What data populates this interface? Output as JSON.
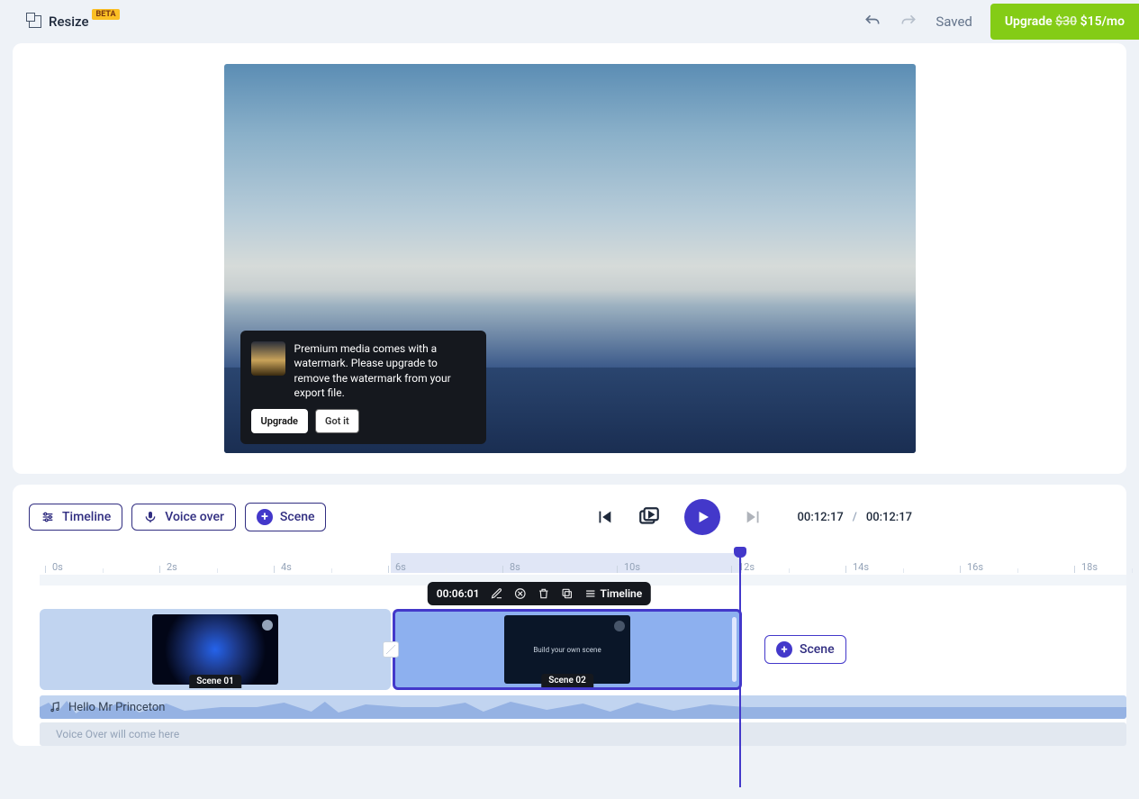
{
  "topbar": {
    "resize_label": "Resize",
    "beta": "BETA",
    "saved": "Saved",
    "upgrade_prefix": "Upgrade ",
    "upgrade_strike": "$30",
    "upgrade_price": " $15/mo"
  },
  "tooltip": {
    "text": "Premium media comes with a watermark. Please upgrade to remove the watermark from your export file.",
    "upgrade": "Upgrade",
    "gotit": "Got it"
  },
  "controls": {
    "timeline": "Timeline",
    "voiceover": "Voice over",
    "scene": "Scene",
    "current": "00:12:17",
    "sep": "/",
    "total": "00:12:17"
  },
  "ruler": {
    "ticks": [
      "0s",
      "2s",
      "4s",
      "6s",
      "8s",
      "10s",
      "12s",
      "14s",
      "16s",
      "18s"
    ]
  },
  "scene_toolbar": {
    "duration": "00:06:01",
    "timeline_label": "Timeline"
  },
  "scenes": {
    "s1_label": "Scene 01",
    "s2_label": "Scene 02",
    "s2_thumb_text": "Build your own scene",
    "add_scene": "Scene"
  },
  "audio": {
    "track_label": "Hello Mr Princeton",
    "vo_placeholder": "Voice Over will come here"
  }
}
